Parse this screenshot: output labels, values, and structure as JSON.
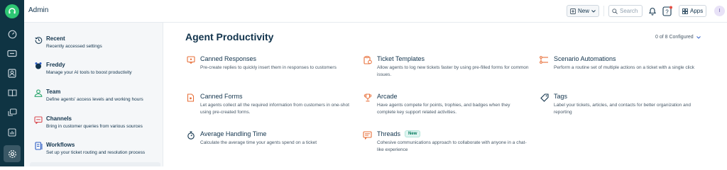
{
  "app": {
    "title": "Admin"
  },
  "header": {
    "new_label": "New",
    "search_placeholder": "Search",
    "notification_badge": "?",
    "apps_label": "Apps",
    "avatar_initial": "I"
  },
  "sidebar": {
    "items": [
      {
        "title": "Recent",
        "desc": "Recently accessed settings",
        "icon": "history-icon"
      },
      {
        "title": "Freddy",
        "desc": "Manage your AI tools to boost productivity",
        "icon": "freddy-ai-icon"
      },
      {
        "title": "Team",
        "desc": "Define agents' access levels and working hours",
        "icon": "team-icon"
      },
      {
        "title": "Channels",
        "desc": "Bring in customer queries from various sources",
        "icon": "channels-icon"
      },
      {
        "title": "Workflows",
        "desc": "Set up your ticket routing and resolution process",
        "icon": "workflows-icon"
      }
    ]
  },
  "main": {
    "title": "Agent Productivity",
    "configured": "0 of 8 Configured",
    "cards": [
      {
        "title": "Canned Responses",
        "desc": "Pre-create replies to quickly insert them in responses to customers",
        "icon": "canned-responses-icon"
      },
      {
        "title": "Ticket Templates",
        "desc": "Allow agents to log new tickets faster by using pre-filled forms for common issues.",
        "icon": "ticket-templates-icon"
      },
      {
        "title": "Scenario Automations",
        "desc": "Perform a routine set of multiple actions on a ticket with a single click",
        "icon": "scenario-automations-icon"
      },
      {
        "title": "Canned Forms",
        "desc": "Let agents collect all the required information from customers in one-shot using pre-created forms.",
        "icon": "canned-forms-icon"
      },
      {
        "title": "Arcade",
        "desc": "Have agents compete for points, trophies, and badges when they complete key support related activities.",
        "icon": "trophy-icon"
      },
      {
        "title": "Tags",
        "desc": "Label your tickets, articles, and contacts for better organization and reporting",
        "icon": "tag-icon"
      },
      {
        "title": "Average Handling Time",
        "desc": "Calculate the average time your agents spend on a ticket",
        "icon": "stopwatch-icon"
      },
      {
        "title": "Threads",
        "badge": "New",
        "desc": "Cohesive communications approach to collaborate with anyone in a chat-like experience",
        "icon": "threads-icon"
      }
    ]
  },
  "colors": {
    "accent": "#2ec774",
    "rail": "#0f3443",
    "icon_orange": "#e8703a",
    "brand_blue": "#2c5cc5"
  }
}
